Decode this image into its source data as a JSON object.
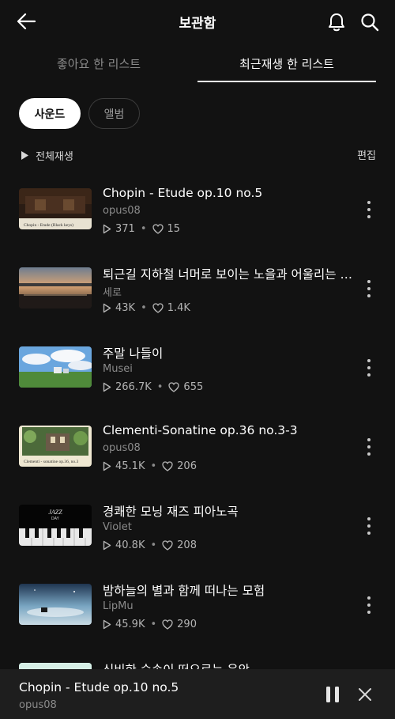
{
  "header": {
    "title": "보관함",
    "back_icon": "arrow-left-icon",
    "bell_icon": "bell-icon",
    "search_icon": "search-icon"
  },
  "tabs": [
    {
      "label": "좋아요 한 리스트",
      "active": false
    },
    {
      "label": "최근재생 한 리스트",
      "active": true
    }
  ],
  "filters": [
    {
      "label": "사운드",
      "selected": true
    },
    {
      "label": "앨범",
      "selected": false
    }
  ],
  "toolbar": {
    "play_all_label": "전체재생",
    "edit_label": "편집"
  },
  "tracks": [
    {
      "title": "Chopin - Etude op.10 no.5",
      "artist": "opus08",
      "plays": "371",
      "likes": "15"
    },
    {
      "title": "퇴근길 지하철 너머로 보이는 노을과 어울리는 피아노",
      "artist": "세로",
      "plays": "43K",
      "likes": "1.4K"
    },
    {
      "title": "주말 나들이",
      "artist": "Musei",
      "plays": "266.7K",
      "likes": "655"
    },
    {
      "title": "Clementi-Sonatine op.36 no.3-3",
      "artist": "opus08",
      "plays": "45.1K",
      "likes": "206"
    },
    {
      "title": "경쾌한 모닝 재즈 피아노곡",
      "artist": "Violet",
      "plays": "40.8K",
      "likes": "208"
    },
    {
      "title": "밤하늘의 별과 함께 떠나는 모험",
      "artist": "LipMu",
      "plays": "45.9K",
      "likes": "290"
    },
    {
      "title": "신비한 숲속이 떠오르는 음악",
      "artist": "",
      "plays": "",
      "likes": ""
    }
  ],
  "thumb_text": {
    "chopin_caption": "Chopin - Etude (Black keys)",
    "clementi_caption": "Clementi - sonatine op.36, no.3",
    "jazz_line1": "JAZZ",
    "jazz_line2": "DAY"
  },
  "now_playing": {
    "title": "Chopin - Etude op.10 no.5",
    "artist": "opus08"
  },
  "colors": {
    "background": "#121212",
    "mini_player": "#1e1e1e",
    "text_secondary": "#8b8b8b"
  }
}
